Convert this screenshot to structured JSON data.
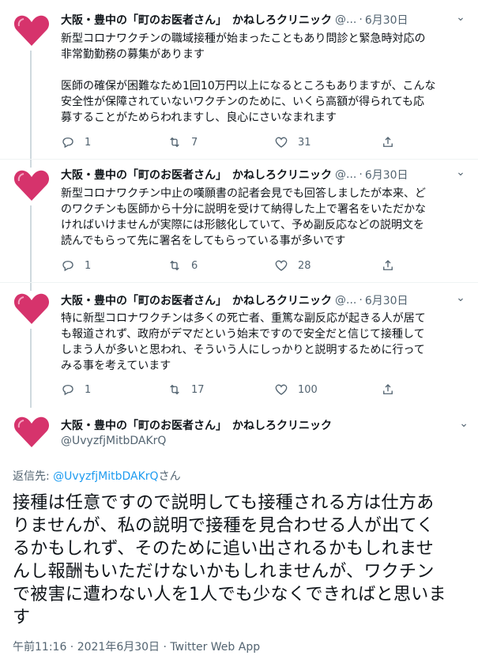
{
  "tweets": [
    {
      "name": "大阪・豊中の「町のお医者さん」　かねしろクリニック",
      "handle": "@...",
      "date": "6月30日",
      "lines": [
        "新型コロナワクチンの職域接種が始まったこともあり問診と緊急時対応の",
        "非常勤勤務の募集があります",
        "",
        "医師の確保が困難なため1回10万円以上になるところもありますが、こんな",
        "安全性が保障されていないワクチンのために、いくら高額が得られても応",
        "募することがためらわれますし、良心にさいなまれます"
      ],
      "replies": "1",
      "retweets": "7",
      "likes": "31"
    },
    {
      "name": "大阪・豊中の「町のお医者さん」　かねしろクリニック",
      "handle": "@...",
      "date": "6月30日",
      "lines": [
        "新型コロナワクチン中止の嘆願書の記者会見でも回答しましたが本来、ど",
        "のワクチンも医師から十分に説明を受けて納得した上で署名をいただかな",
        "ければいけませんが実際には形骸化していて、予め副反応などの説明文を",
        "読んでもらって先に署名をしてもらっている事が多いです"
      ],
      "replies": "1",
      "retweets": "6",
      "likes": "28"
    },
    {
      "name": "大阪・豊中の「町のお医者さん」　かねしろクリニック",
      "handle": "@...",
      "date": "6月30日",
      "lines": [
        "特に新型コロナワクチンは多くの死亡者、重篤な副反応が起きる人が居て",
        "も報道されず、政府がデマだという始末ですので安全だと信じて接種して",
        "しまう人が多いと思われ、そういう人にしっかりと説明するために行って",
        "みる事を考えています"
      ],
      "replies": "1",
      "retweets": "17",
      "likes": "100"
    }
  ],
  "main": {
    "name": "大阪・豊中の「町のお医者さん」　かねしろクリニック",
    "handle": "@UvyzfjMitbDAKrQ",
    "reply_prefix": "返信先: ",
    "reply_mention": "@UvyzfjMitbDAKrQ",
    "reply_suffix": "さん",
    "lines": [
      "接種は任意ですので説明しても接種される方は仕方あ",
      "りませんが、私の説明で接種を見合わせる人が出てく",
      "るかもしれず、そのために追い出されるかもしれませ",
      "んし報酬もいただけないかもしれませんが、ワクチン",
      "で被害に遭わない人を1人でも少なくできればと思いま",
      "す"
    ],
    "meta": "午前11:16 · 2021年6月30日 · Twitter Web App"
  },
  "colors": {
    "heart": "#d6336c",
    "muted": "#536471",
    "link": "#1d9bf0",
    "thread_line": "#cfd9de"
  },
  "icons": {
    "reply": "reply-icon",
    "retweet": "retweet-icon",
    "like": "like-icon",
    "share": "share-icon",
    "more": "more-icon",
    "avatar": "heart-icon"
  }
}
